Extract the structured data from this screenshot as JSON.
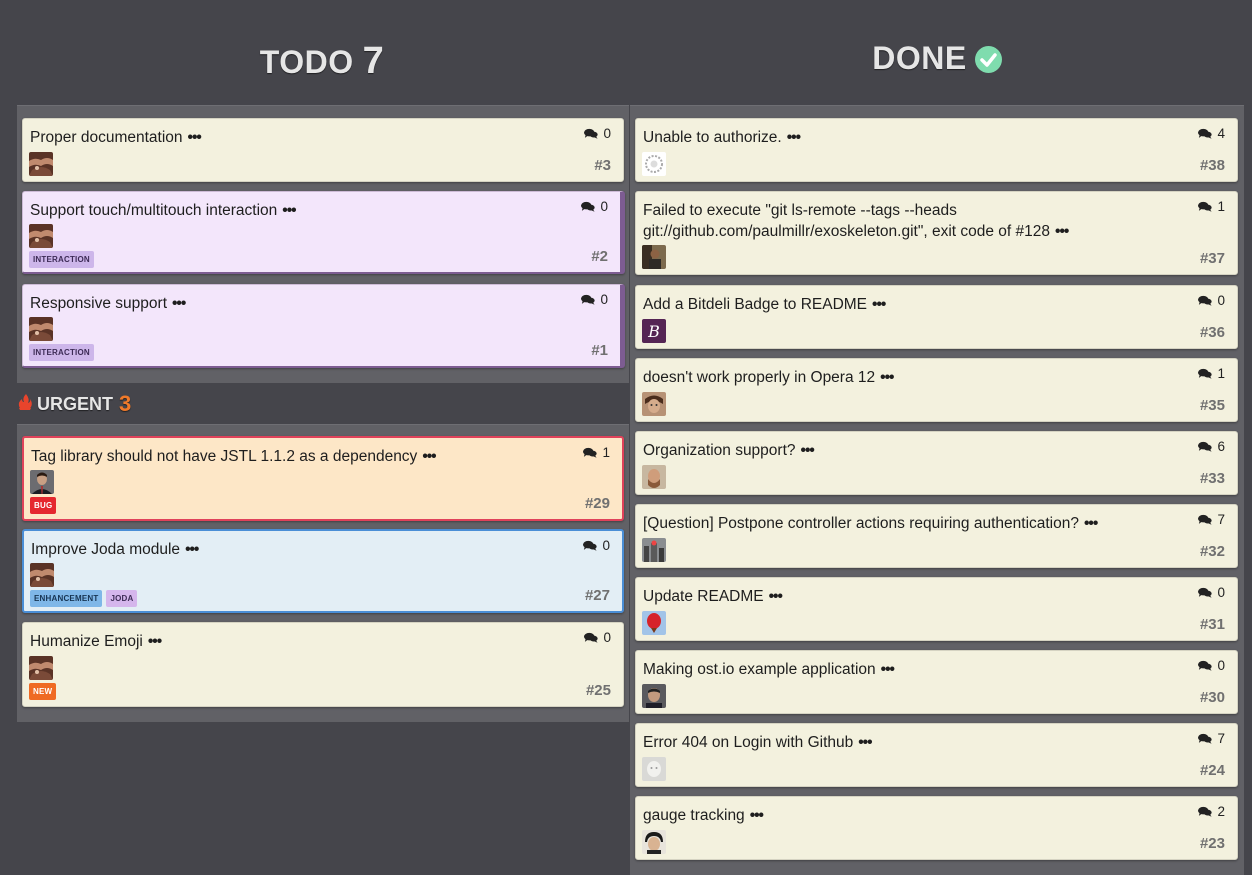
{
  "todo": {
    "title": "TODO",
    "count": "7"
  },
  "urgent": {
    "title": "URGENT",
    "count": "3"
  },
  "done": {
    "title": "DONE"
  },
  "cards": {
    "t1": {
      "title": "Proper documentation",
      "comments": "0",
      "num": "#3"
    },
    "t2": {
      "title": "Support touch/multitouch interaction",
      "comments": "0",
      "num": "#2",
      "label": "INTERACTION"
    },
    "t3": {
      "title": "Responsive support",
      "comments": "0",
      "num": "#1",
      "label": "INTERACTION"
    },
    "u1": {
      "title": "Tag library should not have JSTL 1.1.2 as a dependency",
      "comments": "1",
      "num": "#29",
      "label": "BUG"
    },
    "u2": {
      "title": "Improve Joda module",
      "comments": "0",
      "num": "#27",
      "label1": "ENHANCEMENT",
      "label2": "JODA"
    },
    "u3": {
      "title": "Humanize Emoji",
      "comments": "0",
      "num": "#25",
      "label": "NEW"
    },
    "d1": {
      "title": "Unable to authorize.",
      "comments": "4",
      "num": "#38"
    },
    "d2": {
      "title": "Failed to execute \"git ls-remote --tags --heads git://github.com/paulmillr/exoskeleton.git\", exit code of #128",
      "comments": "1",
      "num": "#37"
    },
    "d3": {
      "title": "Add a Bitdeli Badge to README",
      "comments": "0",
      "num": "#36"
    },
    "d4": {
      "title": "doesn't work properly in Opera 12",
      "comments": "1",
      "num": "#35"
    },
    "d5": {
      "title": "Organization support?",
      "comments": "6",
      "num": "#33"
    },
    "d6": {
      "title": "[Question] Postpone controller actions requiring authentication?",
      "comments": "7",
      "num": "#32"
    },
    "d7": {
      "title": "Update README",
      "comments": "0",
      "num": "#31"
    },
    "d8": {
      "title": "Making ost.io example application",
      "comments": "0",
      "num": "#30"
    },
    "d9": {
      "title": "Error 404 on Login with Github",
      "comments": "7",
      "num": "#24"
    },
    "d10": {
      "title": "gauge tracking",
      "comments": "2",
      "num": "#23"
    }
  },
  "dots": "•••",
  "icons": {
    "comment": "comment-bubbles-icon",
    "check": "check-circle-icon",
    "flame": "flame-icon"
  },
  "colors": {
    "background": "#45454b",
    "lane": "#616166",
    "card": "#f3f1de",
    "purple_card": "#f3e6fb",
    "bug_card": "#fde7c7",
    "enhancement_card": "#e3eef5",
    "accent_orange": "#f07a2a",
    "check_green": "#7fdcae"
  }
}
